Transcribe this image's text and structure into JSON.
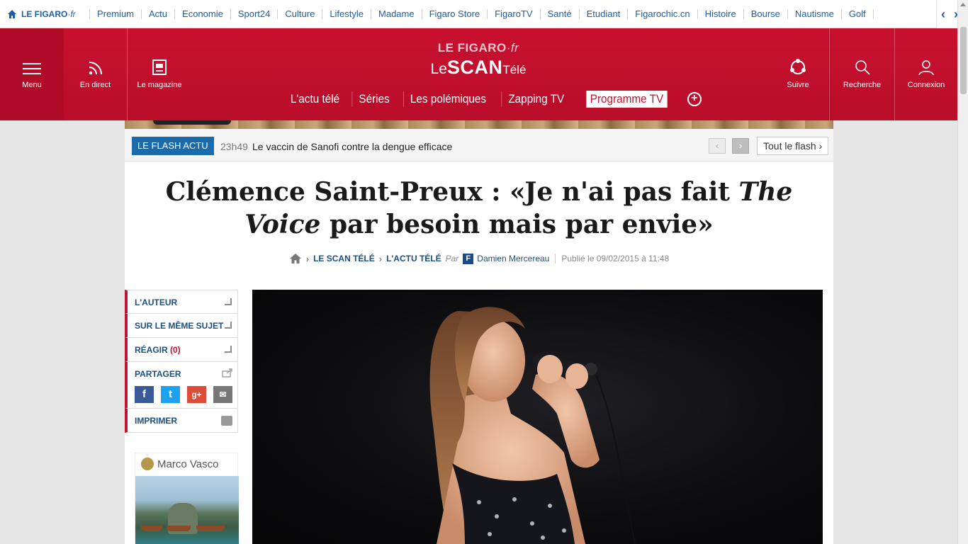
{
  "topbar": {
    "brand_main": "LE FIGARO",
    "brand_suffix": "·fr",
    "links": [
      "Premium",
      "Actu",
      "Economie",
      "Sport24",
      "Culture",
      "Lifestyle",
      "Madame",
      "Figaro Store",
      "FigaroTV",
      "Santé",
      "Etudiant",
      "Figarochic.cn",
      "Histoire",
      "Bourse",
      "Nautisme",
      "Golf"
    ]
  },
  "header": {
    "menu_label": "Menu",
    "live_label": "En direct",
    "magazine_label": "Le magazine",
    "logo_top_main": "LE FIGARO",
    "logo_top_suffix": "·fr",
    "logo_le": "Le",
    "logo_scan": "SCAN",
    "logo_tele": "Télé",
    "follow_label": "Suivre",
    "search_label": "Recherche",
    "login_label": "Connexion",
    "nav": [
      "L'actu télé",
      "Séries",
      "Les polémiques",
      "Zapping TV"
    ],
    "nav_active": "Programme TV"
  },
  "flash": {
    "tag": "LE FLASH ACTU",
    "time": "23h49",
    "text": "Le vaccin de Sanofi contre la dengue efficace",
    "all_label": "Tout le flash"
  },
  "article": {
    "title_part1": "Clémence Saint-Preux : «Je n'ai pas fait ",
    "title_em": "The Voice",
    "title_part2": " par besoin mais par envie»",
    "crumb1": "LE SCAN TÉLÉ",
    "crumb2": "L'ACTU TÉLÉ",
    "by": "Par",
    "author": "Damien Mercereau",
    "published": "Publié le 09/02/2015 à 11:48"
  },
  "tools": {
    "author": "L'AUTEUR",
    "same_topic": "SUR LE MÊME SUJET",
    "react": "RÉAGIR",
    "react_count": "(0)",
    "share": "PARTAGER",
    "print": "IMPRIMER"
  },
  "ad": {
    "brand": "Marco Vasco"
  },
  "icons": {
    "home": "home-icon",
    "menu": "hamburger-icon",
    "live": "rss-icon",
    "magazine": "magazine-icon",
    "follow": "share-network-icon",
    "search": "search-icon",
    "login": "user-icon"
  },
  "colors": {
    "brand_red": "#c4112f",
    "link_blue": "#1a5eab",
    "flash_blue": "#1b6aa9"
  }
}
